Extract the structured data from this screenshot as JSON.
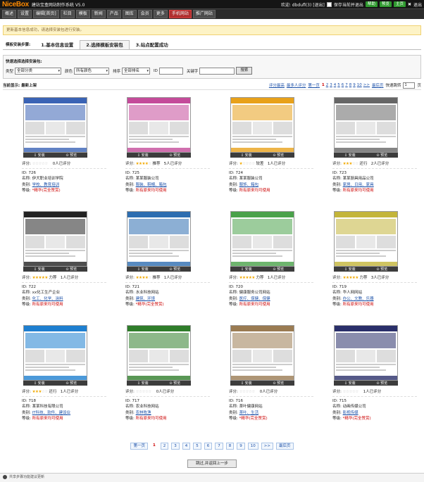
{
  "header": {
    "logo_main": "NiceBox",
    "logo_suffix": "",
    "system_name": "建站宝盒网站制作系统 V5.0",
    "welcome": "欢迎: dbdufl(3) [退出]",
    "checkbox_label": "保存当前并退出",
    "buttons": [
      "帮助",
      "预览",
      "主页"
    ],
    "exit_label": "退出"
  },
  "menu": [
    "概述",
    "设置",
    "编辑[首页]",
    "栏目",
    "模板",
    "新闻",
    "产品",
    "图库",
    "会员",
    "更多",
    "手机网站",
    "推广网站"
  ],
  "notice": "更新基本信息成功，请选择安装包进行安装。",
  "steps": {
    "label": "模板安装步骤:",
    "items": [
      "1.基本信息设置",
      "2.选择模板安装包",
      "3.站点配置成功"
    ],
    "active": 1
  },
  "search": {
    "title": "快速选择选择安装包:",
    "type_label": "类型",
    "type_value": "全部分类",
    "style_label": "颜色",
    "style_value": "所有颜色",
    "sort_label": "排序",
    "sort_value": "全部排名",
    "id_label": "ID",
    "keyword_label": "关键字",
    "button": "搜索"
  },
  "list": {
    "current": "当前显示: 最新上架",
    "sort_score": "评分最高",
    "sort_popular": "最多人评分",
    "first": "第一页",
    "pages": [
      "1",
      "2",
      "3",
      "4",
      "5",
      "6",
      "7",
      "8",
      "9",
      "10",
      ">>"
    ],
    "last": "最后页",
    "jump_label": "快速跳转",
    "jump_value": "1",
    "jump_suffix": "页"
  },
  "labels": {
    "install": "安装",
    "preview": "预览",
    "score": "评分:",
    "id": "ID:",
    "name": "名称:",
    "category": "类别:",
    "grade": "等级:"
  },
  "templates": [
    {
      "rating": 0,
      "rating_word": "",
      "votes": "0人已评分",
      "id": "726",
      "name": "伊犬职业培训学院",
      "category": "学校、教育培训",
      "grade": "*精华(完全赞赏)",
      "theme": "#3a63b5"
    },
    {
      "rating": 4,
      "rating_word": "推荐",
      "votes": "5人已评分",
      "id": "725",
      "name": "某某服装公司",
      "category": "服装、鞋帽、箱包",
      "grade": "所有原来均可使用",
      "theme": "#c44b9a"
    },
    {
      "rating": 1,
      "rating_word": "较差",
      "votes": "1人已评分",
      "id": "724",
      "name": "某某服装公司",
      "category": "服饰、箱包",
      "grade": "所有原来均可使用",
      "theme": "#e8a11a"
    },
    {
      "rating": 3,
      "rating_word": "还行",
      "votes": "2人已评分",
      "id": "723",
      "name": "某某厨具用品公司",
      "category": "家居、日用、家具",
      "grade": "所有原来均可使用",
      "theme": "#666666"
    },
    {
      "rating": 5,
      "rating_word": "力荐",
      "votes": "1人已评分",
      "id": "722",
      "name": "xx化工生产企业",
      "category": "化工、化学、涂料",
      "grade": "所有原来均可使用",
      "theme": "#222222"
    },
    {
      "rating": 4,
      "rating_word": "推荐",
      "votes": "1人已评分",
      "id": "721",
      "name": "水业科技网站",
      "category": "建筑、环境",
      "grade": "*精华(完全赞赏)",
      "theme": "#2d6db0"
    },
    {
      "rating": 5,
      "rating_word": "力荐",
      "votes": "1人已评分",
      "id": "720",
      "name": "健康服务公司网站",
      "category": "医疗、保健、保健",
      "grade": "所有原来均可使用",
      "theme": "#4aa24a"
    },
    {
      "rating": 5,
      "rating_word": "力荐",
      "votes": "3人已评分",
      "id": "719",
      "name": "华人网网站",
      "category": "办公、文教、乐器",
      "grade": "所有原来均可使用",
      "theme": "#c3b53a"
    },
    {
      "rating": 3,
      "rating_word": "还行",
      "votes": "1人已评分",
      "id": "718",
      "name": "某某科技有限公司",
      "category": "IT科技、软件、建设业",
      "grade": "所有原来均可使用",
      "theme": "#1e7fd0"
    },
    {
      "rating": 0,
      "rating_word": "",
      "votes": "0人已评分",
      "id": "717",
      "name": "农业科技网站",
      "category": "农林牧渔",
      "grade": "所有原来均可使用",
      "theme": "#2f7d2a"
    },
    {
      "rating": 0,
      "rating_word": "",
      "votes": "0人已评分",
      "id": "716",
      "name": "茶叶健康网站",
      "category": "茶叶、生活",
      "grade": "*精华(完全赞赏)",
      "theme": "#9a7b52"
    },
    {
      "rating": 0,
      "rating_word": "",
      "votes": "1人已评分",
      "id": "715",
      "name": "动画传媒公司",
      "category": "影视传媒",
      "grade": "*精华(完全赞赏)",
      "theme": "#2a2f6a"
    }
  ],
  "pagination": [
    "第一页",
    "1",
    "2",
    "3",
    "4",
    "5",
    "6",
    "7",
    "8",
    "9",
    "10",
    ">>",
    "最后页"
  ],
  "next_button": "跳过,并返回上一步",
  "footer": "共享步骤功能建议更新"
}
